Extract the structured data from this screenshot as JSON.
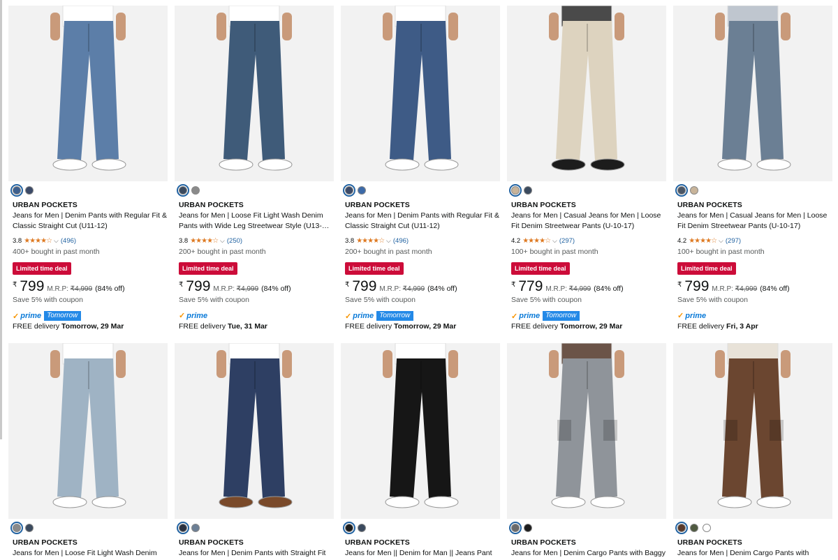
{
  "colors": {
    "deal_bg": "#cc0c39",
    "star": "#de7921",
    "link": "#2162a1",
    "prime": "#0a7ad8",
    "tomorrow_bg": "#2389e7"
  },
  "icons": {
    "star": "star-icon",
    "check": "prime-check-icon",
    "chevron": "chevron-down-icon"
  },
  "row1": [
    {
      "swatches": [
        "#3c5f8e",
        "#3b4a68"
      ],
      "jeans": "#5c7ea8",
      "shirt": "#ffffff",
      "shoe": "#ffffff",
      "brand": "URBAN POCKETS",
      "title": "Jeans for Men | Denim Pants with Regular Fit & Classic Straight Cut (U11-12)",
      "rating": "3.8",
      "stars": "★★★★☆",
      "reviews": "(496)",
      "bought": "400+ bought in past month",
      "deal": "Limited time deal",
      "currency": "₹",
      "price": "799",
      "mrp_label": "M.R.P:",
      "mrp": "₹4,999",
      "off": "(84% off)",
      "coupon": "Save 5% with coupon",
      "prime": "prime",
      "prime_tag": "Tomorrow",
      "delivery_prefix": "FREE delivery",
      "delivery_date": "Tomorrow, 29 Mar"
    },
    {
      "swatches": [
        "#3b4a5e",
        "#8a8a8a"
      ],
      "jeans": "#3f5b79",
      "shirt": "#ffffff",
      "shoe": "#ffffff",
      "brand": "URBAN POCKETS",
      "title": "Jeans for Men | Loose Fit Light Wash Denim Pants with Wide Leg Streetwear Style (U13-…",
      "rating": "3.8",
      "stars": "★★★★☆",
      "reviews": "(250)",
      "bought": "200+ bought in past month",
      "deal": "Limited time deal",
      "currency": "₹",
      "price": "799",
      "mrp_label": "M.R.P:",
      "mrp": "₹4,999",
      "off": "(84% off)",
      "coupon": "Save 5% with coupon",
      "prime": "prime",
      "prime_tag": "",
      "delivery_prefix": "FREE delivery",
      "delivery_date": "Tue, 31 Mar"
    },
    {
      "swatches": [
        "#3b4a68",
        "#3c6aa8"
      ],
      "jeans": "#3e5b86",
      "shirt": "#ffffff",
      "shoe": "#ffffff",
      "brand": "URBAN POCKETS",
      "title": "Jeans for Men | Denim Pants with Regular Fit & Classic Straight Cut (U11-12)",
      "rating": "3.8",
      "stars": "★★★★☆",
      "reviews": "(496)",
      "bought": "200+ bought in past month",
      "deal": "Limited time deal",
      "currency": "₹",
      "price": "799",
      "mrp_label": "M.R.P:",
      "mrp": "₹4,999",
      "off": "(84% off)",
      "coupon": "Save 5% with coupon",
      "prime": "prime",
      "prime_tag": "Tomorrow",
      "delivery_prefix": "FREE delivery",
      "delivery_date": "Tomorrow, 29 Mar"
    },
    {
      "swatches": [
        "#c8b49a",
        "#3b4a5e"
      ],
      "jeans": "#ddd3bf",
      "shirt": "#4a4a4a",
      "shoe": "#1c1c1c",
      "brand": "URBAN POCKETS",
      "title": "Jeans for Men | Casual Jeans for Men | Loose Fit Denim Streetwear Pants (U-10-17)",
      "rating": "4.2",
      "stars": "★★★★☆",
      "reviews": "(297)",
      "bought": "100+ bought in past month",
      "deal": "Limited time deal",
      "currency": "₹",
      "price": "779",
      "mrp_label": "M.R.P:",
      "mrp": "₹4,999",
      "off": "(84% off)",
      "coupon": "Save 5% with coupon",
      "prime": "prime",
      "prime_tag": "Tomorrow",
      "delivery_prefix": "FREE delivery",
      "delivery_date": "Tomorrow, 29 Mar"
    },
    {
      "swatches": [
        "#4a5666",
        "#c8b49a"
      ],
      "jeans": "#6b7f94",
      "shirt": "#bfc6cf",
      "shoe": "#ffffff",
      "brand": "URBAN POCKETS",
      "title": "Jeans for Men | Casual Jeans for Men | Loose Fit Denim Streetwear Pants (U-10-17)",
      "rating": "4.2",
      "stars": "★★★★☆",
      "reviews": "(297)",
      "bought": "100+ bought in past month",
      "deal": "Limited time deal",
      "currency": "₹",
      "price": "799",
      "mrp_label": "M.R.P:",
      "mrp": "₹4,999",
      "off": "(84% off)",
      "coupon": "Save 5% with coupon",
      "prime": "prime",
      "prime_tag": "",
      "delivery_prefix": "FREE delivery",
      "delivery_date": "Fri, 3 Apr"
    }
  ],
  "row2": [
    {
      "swatches": [
        "#8a8a8a",
        "#3b4a5e"
      ],
      "jeans": "#9fb3c4",
      "shirt": "#ffffff",
      "shoe": "#ffffff",
      "brand": "URBAN POCKETS",
      "title": "Jeans for Men | Loose Fit Light Wash Denim"
    },
    {
      "swatches": [
        "#2a3140",
        "#6c7f95"
      ],
      "jeans": "#2e3f63",
      "shirt": "#ffffff",
      "shoe": "#7a4a2a",
      "brand": "URBAN POCKETS",
      "title": "Jeans for Men | Denim Pants with Straight Fit"
    },
    {
      "swatches": [
        "#1c1c1c",
        "#3b4a5e"
      ],
      "jeans": "#161616",
      "shirt": "#ffffff",
      "shoe": "#ffffff",
      "brand": "URBAN POCKETS",
      "title": "Jeans for Men || Denim for Man || Jeans Pant"
    },
    {
      "swatches": [
        "#6a6a6a",
        "#1c1c1c"
      ],
      "jeans": "#8f949a",
      "shirt": "#6b5448",
      "shoe": "#ffffff",
      "brand": "URBAN POCKETS",
      "title": "Jeans for Men | Denim Cargo Pants with Baggy"
    },
    {
      "swatches": [
        "#5a3a2a",
        "#4f5a40",
        "#ffffff"
      ],
      "jeans": "#6b4630",
      "shirt": "#e8e2d8",
      "shoe": "#ffffff",
      "brand": "URBAN POCKETS",
      "title": "Jeans for Men | Denim Cargo Pants with"
    }
  ]
}
